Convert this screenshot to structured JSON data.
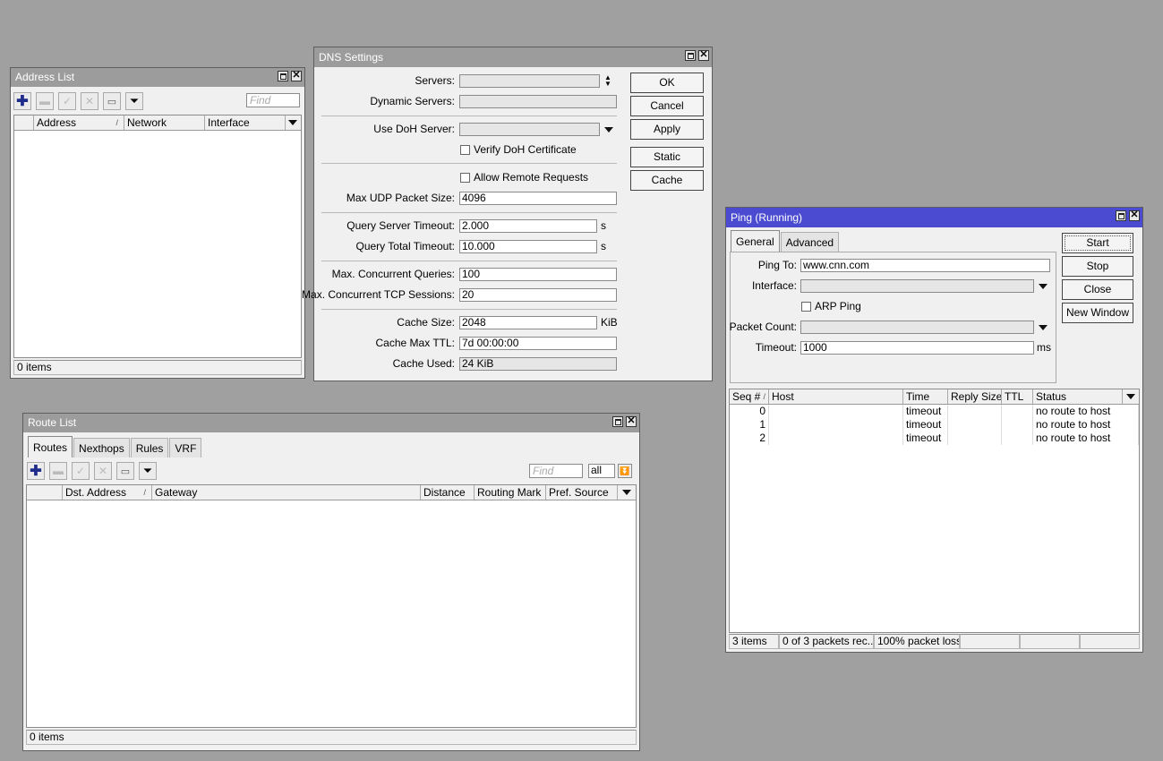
{
  "address_list": {
    "title": "Address List",
    "find_placeholder": "Find",
    "columns": [
      "Address",
      "Network",
      "Interface"
    ],
    "status": "0 items"
  },
  "dns": {
    "title": "DNS Settings",
    "labels": {
      "servers": "Servers:",
      "dynamic_servers": "Dynamic Servers:",
      "use_doh": "Use DoH Server:",
      "verify_doh": "Verify DoH Certificate",
      "allow_remote": "Allow Remote Requests",
      "max_udp": "Max UDP Packet Size:",
      "qs_timeout": "Query Server Timeout:",
      "qt_timeout": "Query Total Timeout:",
      "max_cq": "Max. Concurrent Queries:",
      "max_tcp": "Max. Concurrent TCP Sessions:",
      "cache_size": "Cache Size:",
      "cache_ttl": "Cache Max TTL:",
      "cache_used": "Cache Used:"
    },
    "values": {
      "servers": "",
      "dynamic_servers": "",
      "use_doh": "",
      "max_udp": "4096",
      "qs_timeout": "2.000",
      "qt_timeout": "10.000",
      "max_cq": "100",
      "max_tcp": "20",
      "cache_size": "2048",
      "cache_ttl": "7d 00:00:00",
      "cache_used": "24 KiB"
    },
    "units": {
      "s": "s",
      "kib": "KiB"
    },
    "buttons": {
      "ok": "OK",
      "cancel": "Cancel",
      "apply": "Apply",
      "static": "Static",
      "cache": "Cache"
    }
  },
  "ping": {
    "title": "Ping (Running)",
    "tabs": [
      "General",
      "Advanced"
    ],
    "labels": {
      "ping_to": "Ping To:",
      "interface": "Interface:",
      "arp_ping": "ARP Ping",
      "packet_count": "Packet Count:",
      "timeout": "Timeout:"
    },
    "values": {
      "ping_to": "www.cnn.com",
      "interface": "",
      "packet_count": "",
      "timeout": "1000"
    },
    "units": {
      "ms": "ms"
    },
    "buttons": {
      "start": "Start",
      "stop": "Stop",
      "close": "Close",
      "new_window": "New Window"
    },
    "columns": [
      "Seq #",
      "Host",
      "Time",
      "Reply Size",
      "TTL",
      "Status"
    ],
    "rows": [
      {
        "seq": "0",
        "host": "",
        "time": "timeout",
        "reply": "",
        "ttl": "",
        "status": "no route to host"
      },
      {
        "seq": "1",
        "host": "",
        "time": "timeout",
        "reply": "",
        "ttl": "",
        "status": "no route to host"
      },
      {
        "seq": "2",
        "host": "",
        "time": "timeout",
        "reply": "",
        "ttl": "",
        "status": "no route to host"
      }
    ],
    "status": [
      "3 items",
      "0 of 3 packets rec...",
      "100% packet loss"
    ]
  },
  "route_list": {
    "title": "Route List",
    "tabs": [
      "Routes",
      "Nexthops",
      "Rules",
      "VRF"
    ],
    "find_placeholder": "Find",
    "filter_value": "all",
    "columns": [
      "Dst. Address",
      "Gateway",
      "Distance",
      "Routing Mark",
      "Pref. Source"
    ],
    "status": "0 items"
  }
}
